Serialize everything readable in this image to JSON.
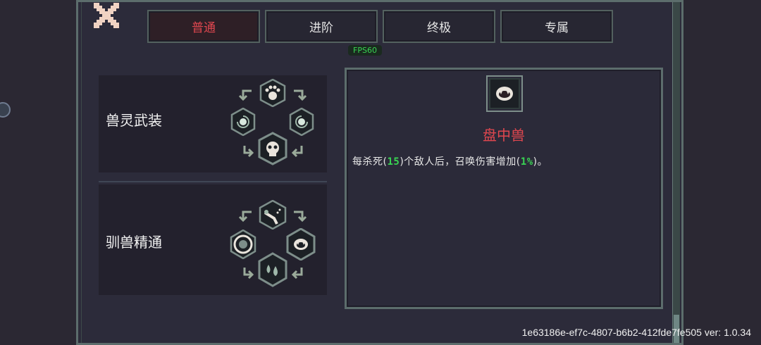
{
  "tabs": [
    {
      "label": "普通",
      "active": true
    },
    {
      "label": "进阶",
      "active": false
    },
    {
      "label": "终极",
      "active": false
    },
    {
      "label": "专属",
      "active": false
    }
  ],
  "fps_label": "FPS60",
  "skill_groups": [
    {
      "name": "兽灵武装",
      "icons": [
        "paw-icon",
        "spiral-left-icon",
        "spiral-right-icon",
        "skull-icon"
      ]
    },
    {
      "name": "驯兽精通",
      "icons": [
        "claw-icon",
        "ring-icon",
        "fanged-mouth-icon",
        "droplets-icon"
      ]
    }
  ],
  "detail": {
    "icon": "fanged-mouth-icon",
    "title": "盘中兽",
    "desc_prefix": "每杀死",
    "desc_value1": "15",
    "desc_middle": "个敌人后，召唤伤害增加",
    "desc_value2": "1%",
    "desc_suffix": "。",
    "paren_open": "(",
    "paren_close": ")"
  },
  "footer_text": "1e63186e-ef7c-4807-b6b2-412fde7fe505 ver: 1.0.34",
  "colors": {
    "accent_red": "#e0474f",
    "highlight_green": "#39d353",
    "frame": "#5c6d6c"
  }
}
